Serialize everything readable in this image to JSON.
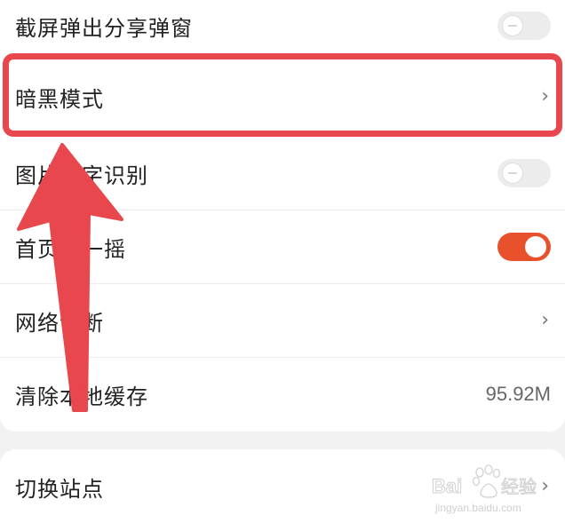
{
  "settings": {
    "rows": [
      {
        "label": "截屏弹出分享弹窗",
        "control": "toggle-off"
      },
      {
        "label": "暗黑模式",
        "control": "chevron"
      },
      {
        "label": "图片文字识别",
        "control": "toggle-off"
      },
      {
        "label": "首页摇一摇",
        "control": "toggle-on"
      },
      {
        "label": "网络诊断",
        "control": "chevron"
      },
      {
        "label": "清除本地缓存",
        "control": "value",
        "value": "95.92M"
      }
    ],
    "switch_site": {
      "label": "切换站点",
      "control": "chevron"
    }
  },
  "chevron_glyph": "›",
  "watermark": {
    "brand": "Bai",
    "brand2": "经验",
    "url": "jingyan.baidu.com"
  },
  "colors": {
    "accent": "#e8512c",
    "highlight": "#e8474d",
    "background": "#f2f2f2",
    "card": "#ffffff"
  }
}
